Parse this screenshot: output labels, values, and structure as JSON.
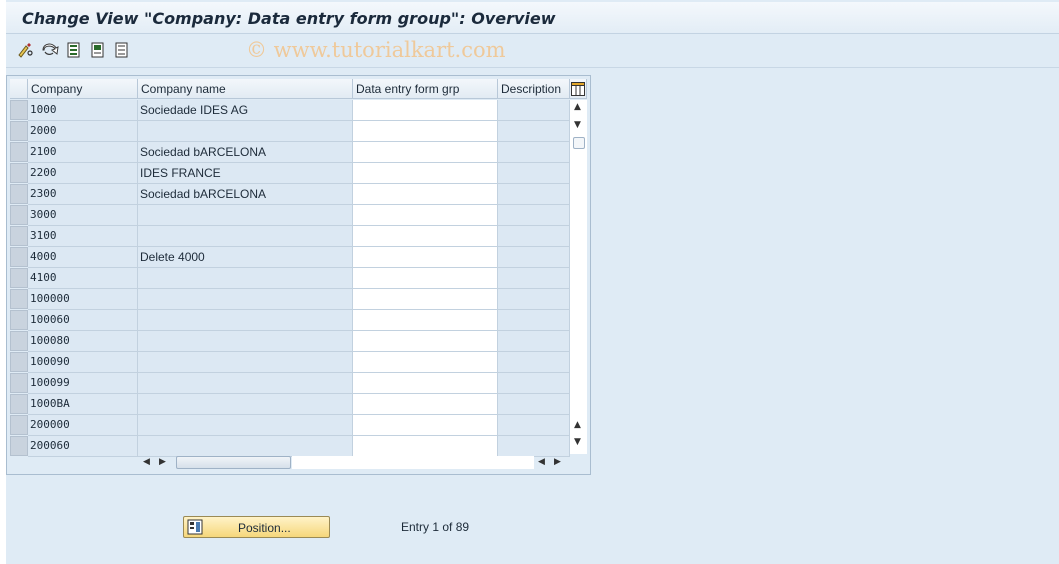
{
  "window": {
    "title": "Change View \"Company: Data entry form group\": Overview"
  },
  "toolbar": {
    "buttons": [
      {
        "icon": "edit-glasses-icon"
      },
      {
        "icon": "undo-icon"
      },
      {
        "icon": "select-all-icon"
      },
      {
        "icon": "select-block-icon"
      },
      {
        "icon": "deselect-all-icon"
      }
    ],
    "watermark": "© www.tutorialkart.com"
  },
  "table": {
    "columns": [
      "Company",
      "Company name",
      "Data entry form grp",
      "Description"
    ],
    "rows": [
      {
        "code": "1000",
        "name": "Sociedade IDES AG",
        "group": "",
        "desc": ""
      },
      {
        "code": "2000",
        "name": "",
        "group": "",
        "desc": ""
      },
      {
        "code": "2100",
        "name": "Sociedad bARCELONA",
        "group": "",
        "desc": ""
      },
      {
        "code": "2200",
        "name": "IDES FRANCE",
        "group": "",
        "desc": ""
      },
      {
        "code": "2300",
        "name": "Sociedad bARCELONA",
        "group": "",
        "desc": ""
      },
      {
        "code": "3000",
        "name": "",
        "group": "",
        "desc": ""
      },
      {
        "code": "3100",
        "name": "",
        "group": "",
        "desc": ""
      },
      {
        "code": "4000",
        "name": "Delete 4000",
        "group": "",
        "desc": ""
      },
      {
        "code": "4100",
        "name": "",
        "group": "",
        "desc": ""
      },
      {
        "code": "100000",
        "name": "",
        "group": "",
        "desc": ""
      },
      {
        "code": "100060",
        "name": "",
        "group": "",
        "desc": ""
      },
      {
        "code": "100080",
        "name": "",
        "group": "",
        "desc": ""
      },
      {
        "code": "100090",
        "name": "",
        "group": "",
        "desc": ""
      },
      {
        "code": "100099",
        "name": "",
        "group": "",
        "desc": ""
      },
      {
        "code": "1000BA",
        "name": "",
        "group": "",
        "desc": ""
      },
      {
        "code": "200000",
        "name": "",
        "group": "",
        "desc": ""
      },
      {
        "code": "200060",
        "name": "",
        "group": "",
        "desc": ""
      }
    ]
  },
  "footer": {
    "position_label": "Position...",
    "entry_text": "Entry 1 of 89"
  },
  "colors": {
    "background": "#dfebf5",
    "button": "#f6d77b",
    "watermark": "#efc99a"
  }
}
